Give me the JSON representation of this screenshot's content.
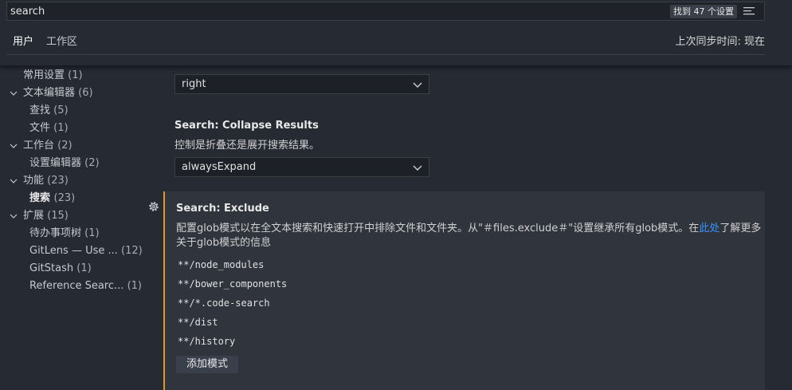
{
  "search": {
    "value": "search",
    "result_count": "找到 47 个设置"
  },
  "tabs": [
    {
      "label": "用户"
    },
    {
      "label": "工作区"
    }
  ],
  "sync_status": "上次同步时间: 现在",
  "toc": [
    {
      "label": "常用设置",
      "count": "(1)"
    },
    {
      "label": "文本编辑器",
      "count": "(6)"
    },
    {
      "label": "查找",
      "count": "(5)"
    },
    {
      "label": "文件",
      "count": "(1)"
    },
    {
      "label": "工作台",
      "count": "(2)"
    },
    {
      "label": "设置编辑器",
      "count": "(2)"
    },
    {
      "label": "功能",
      "count": "(23)"
    },
    {
      "label": "搜索",
      "count": "(23)"
    },
    {
      "label": "扩展",
      "count": "(15)"
    },
    {
      "label": "待办事项树",
      "count": "(1)"
    },
    {
      "label": "GitLens — Use ...",
      "count": "(12)"
    },
    {
      "label": "GitStash",
      "count": "(1)"
    },
    {
      "label": "Reference Searc...",
      "count": "(1)"
    }
  ],
  "settings": {
    "prev_select_value": "right",
    "collapse": {
      "title": "Search: Collapse Results",
      "description": "控制是折叠还是展开搜索结果。",
      "value": "alwaysExpand"
    },
    "exclude": {
      "title": "Search: Exclude",
      "desc_part1": "配置glob模式以在全文本搜索和快速打开中排除文件和文件夹。从\"＃files.exclude＃\"设置继承所有glob模式。在",
      "desc_link": "此处",
      "desc_part2": "了解更多",
      "desc_line2": "关于glob模式的信息",
      "patterns": [
        "**/node_modules",
        "**/bower_components",
        "**/*.code-search",
        "**/dist",
        "**/history"
      ],
      "add_label": "添加模式"
    }
  },
  "colors": {
    "background": "#262a33",
    "accent_border": "#e09a2c",
    "link": "#3794ff"
  }
}
